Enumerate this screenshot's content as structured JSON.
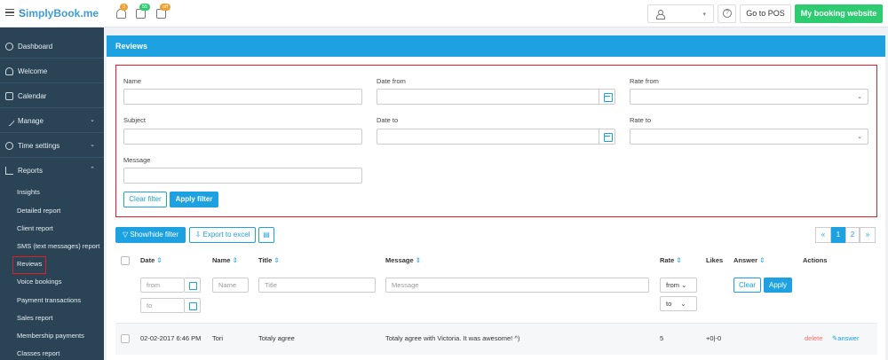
{
  "topbar": {
    "logo_s": "S",
    "logo_rest": "implyBook.me",
    "badges": [
      "3",
      "55",
      "off"
    ],
    "pos_label": "Go to POS",
    "site_label": "My booking website",
    "help_label": "?"
  },
  "sidebar": {
    "items": [
      {
        "label": "Dashboard"
      },
      {
        "label": "Welcome"
      },
      {
        "label": "Calendar"
      },
      {
        "label": "Manage"
      },
      {
        "label": "Time settings"
      },
      {
        "label": "Reports"
      }
    ],
    "sub_items": [
      "Insights",
      "Detailed report",
      "Client report",
      "SMS (text messages) report",
      "Reviews",
      "Voice bookings",
      "Payment transactions",
      "Sales report",
      "Membership payments",
      "Classes report"
    ]
  },
  "panel": {
    "title": "Reviews",
    "filter": {
      "name_label": "Name",
      "date_from_label": "Date from",
      "rate_from_label": "Rate from",
      "subject_label": "Subject",
      "date_to_label": "Date to",
      "rate_to_label": "Rate to",
      "message_label": "Message",
      "clear_label": "Clear filter",
      "apply_label": "Apply filter"
    },
    "toolbar": {
      "show_hide_label": "Show/hide filter",
      "export_label": "Export to excel"
    },
    "pagination": {
      "prev": "«",
      "pages": [
        "1",
        "2"
      ],
      "next": "»"
    },
    "table": {
      "headers": {
        "date": "Date",
        "name": "Name",
        "title": "Title",
        "message": "Message",
        "rate": "Rate",
        "likes": "Likes",
        "answer": "Answer",
        "actions": "Actions"
      },
      "filters": {
        "from_placeholder": "from",
        "to_placeholder": "to",
        "name_placeholder": "Name",
        "title_placeholder": "Title",
        "message_placeholder": "Message",
        "rate_from": "from",
        "rate_to": "to",
        "clear_label": "Clear",
        "apply_label": "Apply"
      },
      "rows": [
        {
          "date": "02-02-2017 6:46 PM",
          "name": "Tori",
          "title": "Totaly agree",
          "message": "Totaly agree with Victoria. It was awesome! ^)",
          "rate": "5",
          "likes": "+0|-0",
          "delete": "delete",
          "answer": "answer"
        }
      ]
    }
  },
  "colors": {
    "accent": "#1da1e0",
    "sidebar": "#2a4456",
    "success": "#2ecc71",
    "highlight": "#e02020"
  }
}
